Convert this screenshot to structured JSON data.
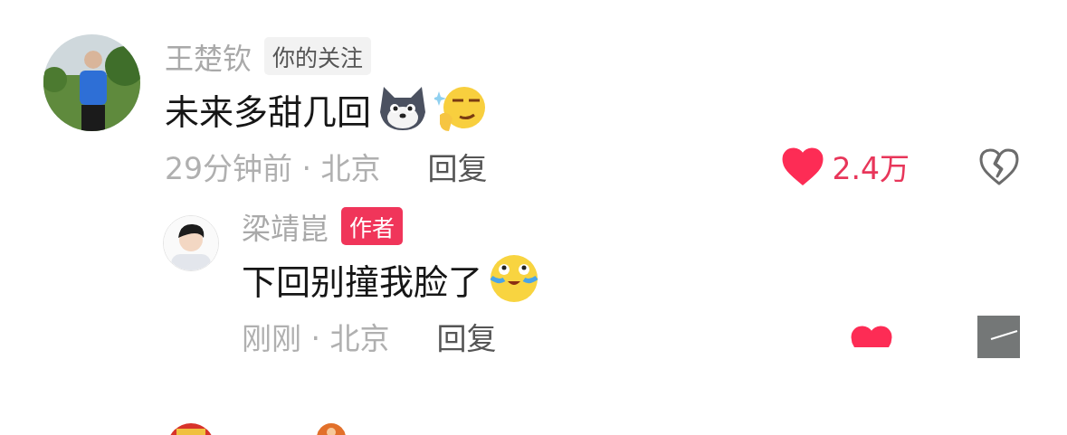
{
  "comments": [
    {
      "author": "王楚钦",
      "badge": {
        "kind": "following",
        "text": "你的关注"
      },
      "content": "未来多甜几回",
      "emojis": [
        {
          "kind": "dog"
        },
        {
          "kind": "smirk"
        }
      ],
      "time_location": "29分钟前 · 北京",
      "reply_label": "回复",
      "likes": "2.4万",
      "liked": true,
      "replies": [
        {
          "author": "梁靖崑",
          "badge": {
            "kind": "author",
            "text": "作者"
          },
          "content": "下回别撞我脸了",
          "emojis": [
            {
              "kind": "crying-laugh"
            }
          ],
          "time_location": "刚刚 · 北京",
          "reply_label": "回复",
          "liked": true
        }
      ]
    }
  ]
}
